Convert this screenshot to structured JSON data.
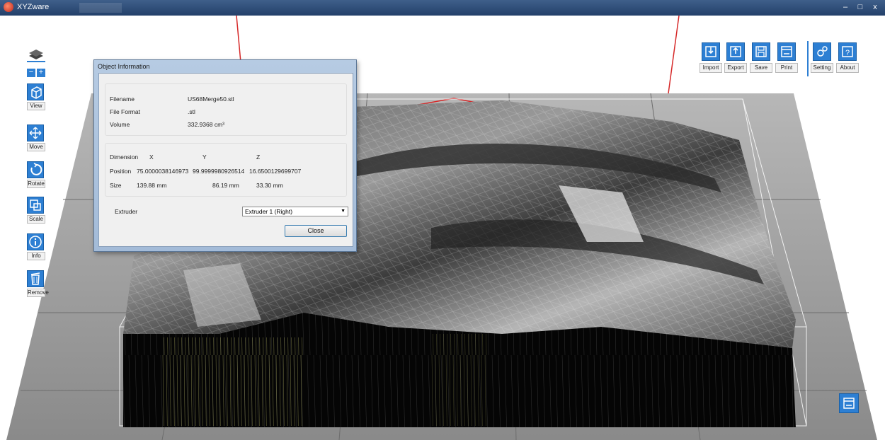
{
  "window": {
    "title": "XYZware",
    "controls": {
      "minimize": "–",
      "maximize": "□",
      "close": "x"
    }
  },
  "left_toolbar": {
    "zoom": {
      "minus": "−",
      "plus": "+"
    },
    "tools": [
      {
        "icon": "cube-icon",
        "label": "View"
      },
      {
        "icon": "move-arrows-icon",
        "label": "Move"
      },
      {
        "icon": "rotate-icon",
        "label": "Rotate"
      },
      {
        "icon": "scale-icon",
        "label": "Scale"
      },
      {
        "icon": "info-icon",
        "label": "Info"
      },
      {
        "icon": "trash-icon",
        "label": "Remove"
      }
    ]
  },
  "right_toolbar": {
    "buttons": [
      {
        "icon": "import-icon",
        "label": "Import"
      },
      {
        "icon": "export-icon",
        "label": "Export"
      },
      {
        "icon": "save-icon",
        "label": "Save"
      },
      {
        "icon": "print-icon",
        "label": "Print"
      },
      {
        "icon": "gear-icon",
        "label": "Setting"
      },
      {
        "icon": "question-icon",
        "label": "About"
      }
    ]
  },
  "dialog": {
    "title": "Object Information",
    "file": {
      "filename_label": "Filename",
      "filename_value": "US68Merge50.stl",
      "format_label": "File Format",
      "format_value": ".stl",
      "volume_label": "Volume",
      "volume_value": "332.9368 cm³"
    },
    "dimension": {
      "header_label": "Dimension",
      "x": "X",
      "y": "Y",
      "z": "Z",
      "position_label": "Position",
      "position_x": "75.0000038146973",
      "position_y": "99.9999980926514",
      "position_z": "16.6500129699707",
      "size_label": "Size",
      "size_x": "139.88 mm",
      "size_y": "86.19 mm",
      "size_z": "33.30 mm"
    },
    "extruder_label": "Extruder",
    "extruder_value": "Extruder 1 (Right)",
    "close_label": "Close"
  },
  "colors": {
    "accent": "#2d7fd3",
    "titlebar": "#2f4f7a",
    "bed_grid": "#7a7a7a",
    "printer_frame": "#d62828"
  }
}
